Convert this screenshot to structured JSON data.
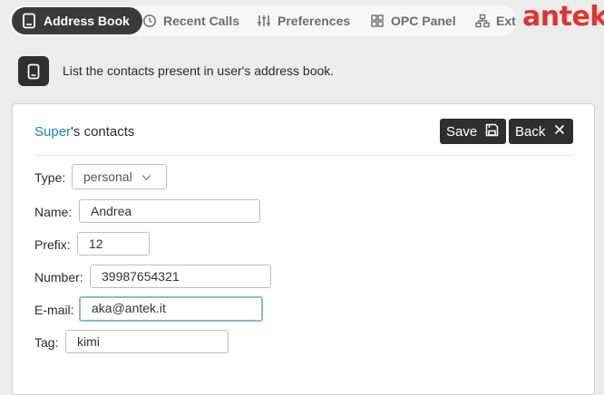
{
  "nav": {
    "tabs": [
      {
        "label": "Address Book",
        "icon": "address-book-icon",
        "active": true
      },
      {
        "label": "Recent Calls",
        "icon": "clock-icon",
        "active": false
      },
      {
        "label": "Preferences",
        "icon": "sliders-icon",
        "active": false
      },
      {
        "label": "OPC Panel",
        "icon": "grid-icon",
        "active": false
      },
      {
        "label": "Ext",
        "icon": "network-icon",
        "active": false
      }
    ],
    "logo": "antek"
  },
  "description": {
    "icon": "book-icon",
    "text": "List the contacts present in user's address book."
  },
  "panel": {
    "title_owner": "Super",
    "title_rest": "'s contacts",
    "save_label": "Save",
    "back_label": "Back"
  },
  "form": {
    "type": {
      "label": "Type:",
      "value": "personal"
    },
    "name": {
      "label": "Name:",
      "value": "Andrea"
    },
    "prefix": {
      "label": "Prefix:",
      "value": "12"
    },
    "number": {
      "label": "Number:",
      "value": "39987654321"
    },
    "email": {
      "label": "E-mail:",
      "value": "aka@antek.it"
    },
    "tag": {
      "label": "Tag:",
      "value": "kimi"
    }
  },
  "colors": {
    "accent": "#e0342e",
    "link": "#1a86c8",
    "dark": "#2f2f2f"
  }
}
